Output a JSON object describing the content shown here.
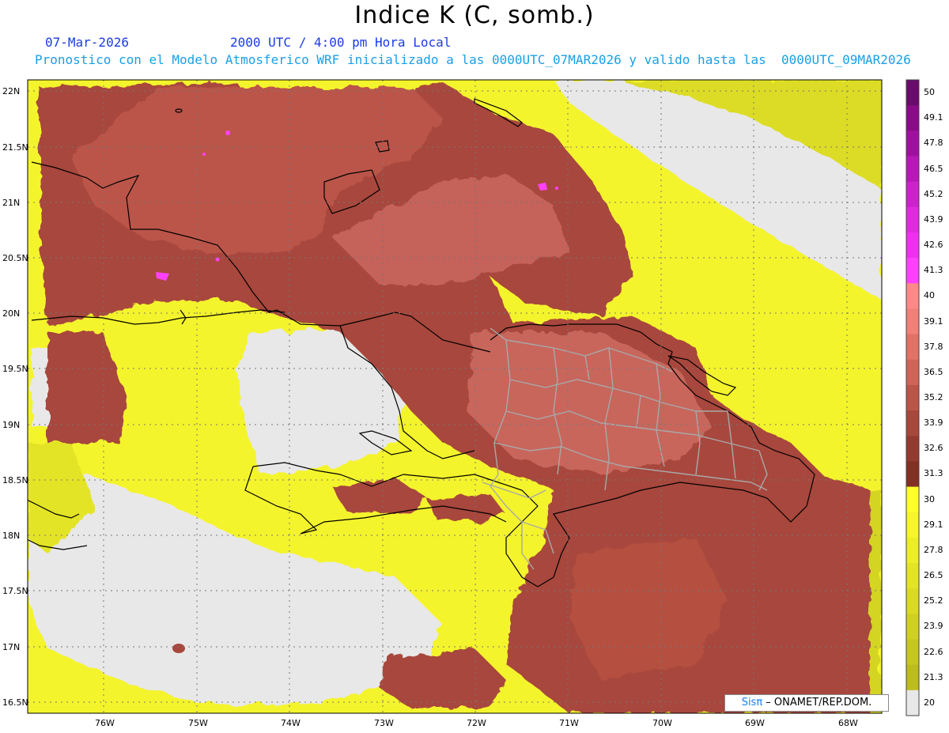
{
  "header": {
    "title": "Indice K (C, somb.)",
    "date": "07-Mar-2026",
    "time": "2000 UTC / 4:00 pm Hora Local",
    "description": "Pronostico con el Modelo Atmosferico WRF inicializado a las 0000UTC_07MAR2026 y valido hasta las  0000UTC_09MAR2026"
  },
  "axes": {
    "lat_labels": [
      "22N",
      "21.5N",
      "21N",
      "20.5N",
      "20N",
      "19.5N",
      "19N",
      "18.5N",
      "18N",
      "17.5N",
      "17N",
      "16.5N"
    ],
    "lon_labels": [
      "76W",
      "75W",
      "74W",
      "73W",
      "72W",
      "71W",
      "70W",
      "69W",
      "68W"
    ]
  },
  "colorbar": {
    "labels": [
      "50",
      "49.1",
      "47.8",
      "46.5",
      "45.2",
      "43.9",
      "42.6",
      "41.3",
      "40",
      "39.1",
      "37.8",
      "36.5",
      "35.2",
      "33.9",
      "32.6",
      "31.3",
      "30",
      "29.1",
      "27.8",
      "26.5",
      "25.2",
      "23.9",
      "22.6",
      "21.3",
      "20"
    ],
    "colors": [
      "#6a0a6a",
      "#8a0a8a",
      "#a010a0",
      "#b818b8",
      "#cc22cc",
      "#e02ae0",
      "#f030f0",
      "#ff40ff",
      "#ff8888",
      "#f08078",
      "#e07266",
      "#d06458",
      "#bb5548",
      "#a8473c",
      "#953a30",
      "#823024",
      "#ffff2a",
      "#f6f62a",
      "#eeee28",
      "#e4e426",
      "#dada24",
      "#d0d022",
      "#c6c620",
      "#bcbc1e",
      "#e8e8e8"
    ]
  },
  "credit": {
    "logo": "Sisπ",
    "text": " – ONAMET/REP.DOM."
  }
}
